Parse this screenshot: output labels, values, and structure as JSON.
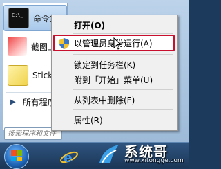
{
  "programs": [
    {
      "label": "命令提示符",
      "icon": "command-prompt-icon"
    },
    {
      "label": "截图工具",
      "icon": "snipping-tool-icon"
    },
    {
      "label": "Sticky Notes",
      "icon": "sticky-notes-icon"
    }
  ],
  "all_programs": {
    "label": "所有程序",
    "arrow": "▶"
  },
  "search": {
    "placeholder": "搜索程序和文件"
  },
  "context_menu": {
    "open": "打开(O)",
    "run_as_admin": "以管理员身份运行(A)",
    "pin_taskbar": "锁定到任务栏(K)",
    "pin_start": "附到「开始」菜单(U)",
    "remove_list": "从列表中删除(F)",
    "properties": "属性(R)"
  },
  "logo": {
    "title": "系统哥",
    "url": "www.xitongge.com"
  },
  "colors": {
    "highlight_border": "#c8102e",
    "accent": "#1e64b4"
  }
}
